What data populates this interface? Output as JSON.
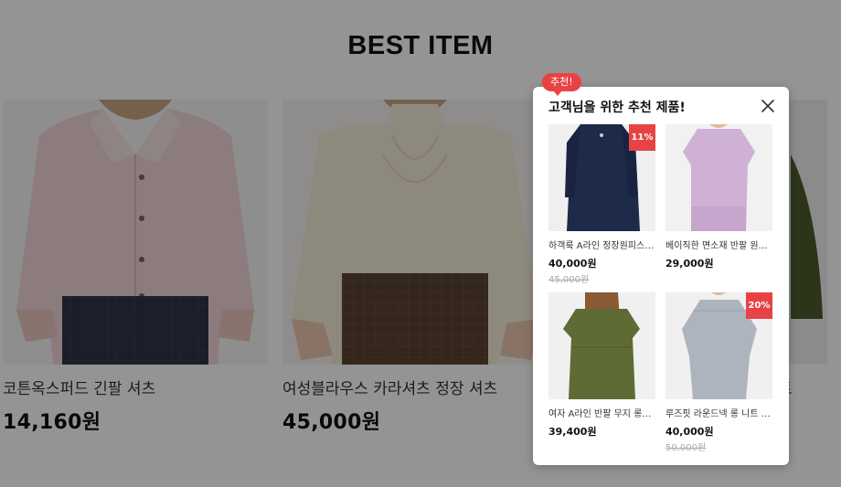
{
  "section": {
    "title": "BEST ITEM"
  },
  "products": [
    {
      "name": "코튼옥스퍼드 긴팔 셔츠",
      "price": "14,160원"
    },
    {
      "name": "여성블라우스 카라셔츠 정장 셔츠",
      "price": "45,000원"
    },
    {
      "name": "트",
      "price": ""
    }
  ],
  "popup": {
    "badge": "추천!",
    "title": "고객님을 위한 추천 제품!",
    "close_icon": "close-icon",
    "items": [
      {
        "name": "하객룩 A라인 정장원피스 블라우스",
        "price": "40,000원",
        "original_price": "45,000원",
        "discount": "11%"
      },
      {
        "name": "베이직한 면소재 반팔 원피스",
        "price": "29,000원",
        "original_price": "",
        "discount": ""
      },
      {
        "name": "여자 A라인 반팔 무지 롱원피스",
        "price": "39,400원",
        "original_price": "",
        "discount": ""
      },
      {
        "name": "루즈핏 라운드넥 롱 니트 원피스",
        "price": "40,000원",
        "original_price": "50,000원",
        "discount": "20%"
      }
    ]
  },
  "colors": {
    "accent": "#e74345",
    "overlay": "rgba(0,0,0,0.42)"
  }
}
